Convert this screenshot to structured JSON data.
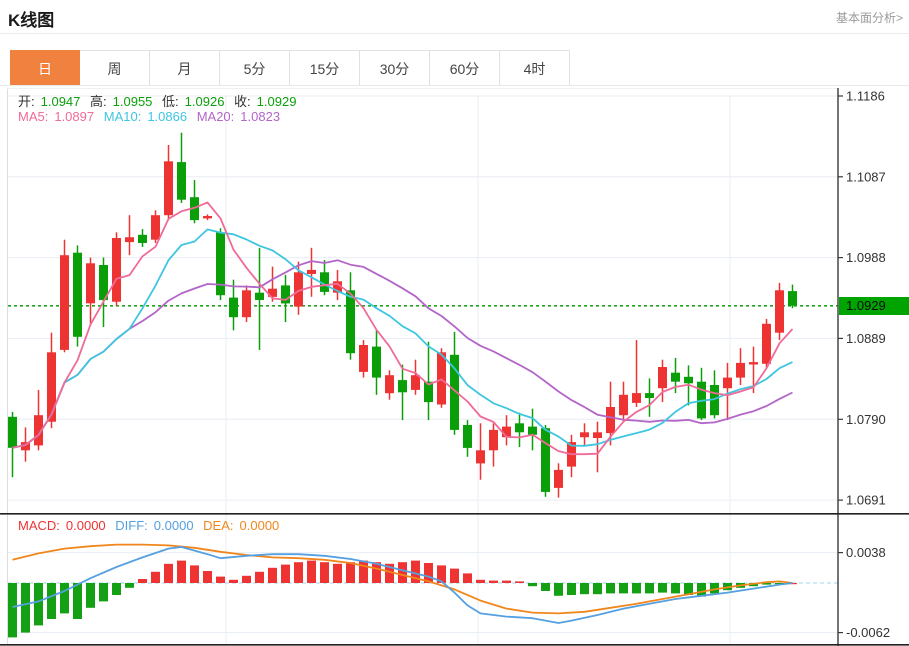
{
  "header": {
    "title": "K线图",
    "link": "基本面分析>"
  },
  "tabs": {
    "items": [
      "日",
      "周",
      "月",
      "5分",
      "15分",
      "30分",
      "60分",
      "4时"
    ],
    "active_index": 0
  },
  "ohlc": {
    "open_label": "开:",
    "open": "1.0947",
    "high_label": "高:",
    "high": "1.0955",
    "low_label": "低:",
    "low": "1.0926",
    "close_label": "收:",
    "close": "1.0929"
  },
  "ma": {
    "ma5_label": "MA5:",
    "ma5": "1.0897",
    "ma10_label": "MA10:",
    "ma10": "1.0866",
    "ma20_label": "MA20:",
    "ma20": "1.0823"
  },
  "macd_info": {
    "macd_label": "MACD:",
    "macd": "0.0000",
    "diff_label": "DIFF:",
    "diff": "0.0000",
    "dea_label": "DEA:",
    "dea": "0.0000"
  },
  "price_tag": {
    "value": "1.0929"
  },
  "colors": {
    "up_red": "#ee3333",
    "down_green": "#0a9e08",
    "ma5_pink": "#f06a9a",
    "ma10_cyan": "#3ec6e0",
    "ma20_purple": "#b365c8",
    "diff_blue": "#55a0e0",
    "dea_orange": "#f0861c",
    "hist_red": "#ee3333",
    "hist_green": "#14a014",
    "tag_green": "#00a400",
    "dotted_line_green": "#1fa81f",
    "tab_active_orange": "#f0813f",
    "grid": "#e9eef4",
    "axis_dark": "#3a3a3a",
    "zero_dash_blue": "#9ed4e8"
  },
  "chart_data": {
    "type": "candlestick+macd",
    "title": "K线图 (日)",
    "price_axis_ticks": [
      1.1186,
      1.1087,
      1.0988,
      1.0889,
      1.079,
      1.0691
    ],
    "current_price": 1.0929,
    "ma_periods": [
      5,
      10,
      20
    ],
    "macd_axis_ticks": [
      0.0038,
      -0.0062
    ],
    "candles": [
      [
        1.0793,
        1.0799,
        1.0719,
        1.0755
      ],
      [
        1.0752,
        1.078,
        1.0738,
        1.0762
      ],
      [
        1.0758,
        1.0826,
        1.0752,
        1.0795
      ],
      [
        1.0787,
        1.0896,
        1.0779,
        1.0872
      ],
      [
        1.0875,
        1.101,
        1.0872,
        1.0991
      ],
      [
        1.0994,
        1.1003,
        1.0879,
        1.0891
      ],
      [
        1.0932,
        1.0988,
        1.0906,
        1.0981
      ],
      [
        1.0979,
        1.0988,
        1.0903,
        1.0936
      ],
      [
        1.0934,
        1.1019,
        1.0929,
        1.1012
      ],
      [
        1.1007,
        1.104,
        1.0991,
        1.1013
      ],
      [
        1.1016,
        1.1023,
        1.1001,
        1.1006
      ],
      [
        1.101,
        1.1046,
        1.1006,
        1.104
      ],
      [
        1.104,
        1.1126,
        1.1034,
        1.1106
      ],
      [
        1.1105,
        1.1141,
        1.1055,
        1.1059
      ],
      [
        1.1062,
        1.1083,
        1.103,
        1.1034
      ],
      [
        1.1036,
        1.1041,
        1.1034,
        1.1039
      ],
      [
        1.1019,
        1.1024,
        1.0936,
        1.0942
      ],
      [
        1.0939,
        1.0961,
        1.0899,
        1.0915
      ],
      [
        1.0915,
        1.0954,
        1.0909,
        1.0948
      ],
      [
        1.0945,
        1.1,
        1.0875,
        1.0936
      ],
      [
        1.094,
        1.0977,
        1.0934,
        1.095
      ],
      [
        1.0954,
        1.0967,
        1.0909,
        1.0932
      ],
      [
        1.0928,
        1.0983,
        1.0918,
        1.097
      ],
      [
        1.0968,
        1.1,
        1.094,
        1.0973
      ],
      [
        1.097,
        1.0985,
        1.0942,
        1.0946
      ],
      [
        1.0945,
        1.0973,
        1.0936,
        1.0959
      ],
      [
        1.0948,
        1.097,
        1.0863,
        1.0871
      ],
      [
        1.0848,
        1.0887,
        1.0841,
        1.0881
      ],
      [
        1.0879,
        1.0899,
        1.082,
        1.0841
      ],
      [
        1.0822,
        1.085,
        1.0814,
        1.0844
      ],
      [
        1.0838,
        1.0857,
        1.0789,
        1.0823
      ],
      [
        1.0826,
        1.0863,
        1.082,
        1.0844
      ],
      [
        1.0836,
        1.0885,
        1.0789,
        1.0811
      ],
      [
        1.0808,
        1.0877,
        1.0804,
        1.0872
      ],
      [
        1.0869,
        1.0897,
        1.0771,
        1.0777
      ],
      [
        1.0783,
        1.0789,
        1.0744,
        1.0755
      ],
      [
        1.0736,
        1.0785,
        1.0716,
        1.0752
      ],
      [
        1.0752,
        1.0785,
        1.0732,
        1.0777
      ],
      [
        1.0768,
        1.0795,
        1.0758,
        1.0781
      ],
      [
        1.0785,
        1.0798,
        1.0756,
        1.0774
      ],
      [
        1.0781,
        1.0803,
        1.0752,
        1.0771
      ],
      [
        1.0779,
        1.0783,
        1.0695,
        1.0701
      ],
      [
        1.0706,
        1.0736,
        1.0694,
        1.0728
      ],
      [
        1.0732,
        1.0771,
        1.0719,
        1.0762
      ],
      [
        1.0768,
        1.0785,
        1.0758,
        1.0774
      ],
      [
        1.0767,
        1.0787,
        1.0725,
        1.0774
      ],
      [
        1.0773,
        1.0836,
        1.0758,
        1.0805
      ],
      [
        1.0795,
        1.0836,
        1.0787,
        1.082
      ],
      [
        1.081,
        1.0887,
        1.0805,
        1.0822
      ],
      [
        1.0822,
        1.084,
        1.0793,
        1.0816
      ],
      [
        1.0828,
        1.0863,
        1.0811,
        1.0854
      ],
      [
        1.0847,
        1.0865,
        1.0822,
        1.0836
      ],
      [
        1.0842,
        1.0856,
        1.0807,
        1.0834
      ],
      [
        1.0836,
        1.0853,
        1.0789,
        1.0791
      ],
      [
        1.0832,
        1.085,
        1.0791,
        1.0795
      ],
      [
        1.0828,
        1.0859,
        1.0789,
        1.0841
      ],
      [
        1.0841,
        1.0877,
        1.0832,
        1.0859
      ],
      [
        1.0857,
        1.0879,
        1.0822,
        1.086
      ],
      [
        1.0858,
        1.0913,
        1.0852,
        1.0907
      ],
      [
        1.0896,
        1.0957,
        1.0887,
        1.0948
      ],
      [
        1.0947,
        1.0955,
        1.0926,
        1.0929
      ]
    ],
    "macd_hist": [
      -0.0068,
      -0.0062,
      -0.0053,
      -0.0045,
      -0.0038,
      -0.0045,
      -0.0031,
      -0.0023,
      -0.0015,
      -0.0006,
      0.0005,
      0.0014,
      0.0024,
      0.0028,
      0.0022,
      0.0015,
      0.0008,
      0.0004,
      0.0009,
      0.0014,
      0.0019,
      0.0023,
      0.0026,
      0.0028,
      0.0026,
      0.0024,
      0.0026,
      0.0028,
      0.0026,
      0.0024,
      0.0026,
      0.0028,
      0.0025,
      0.0022,
      0.0018,
      0.0012,
      0.0004,
      0.0003,
      0.0003,
      0.0002,
      -0.0004,
      -0.001,
      -0.0016,
      -0.0015,
      -0.0014,
      -0.0014,
      -0.0013,
      -0.0013,
      -0.0013,
      -0.0013,
      -0.0012,
      -0.0013,
      -0.0015,
      -0.0017,
      -0.0013,
      -0.0009,
      -0.0006,
      -0.0004,
      -0.0002,
      -0.0001,
      0.0
    ],
    "diff_points": [
      [
        0,
        -0.003
      ],
      [
        2,
        -0.0023
      ],
      [
        4,
        -0.001
      ],
      [
        6,
        0.0006
      ],
      [
        8,
        0.002
      ],
      [
        10,
        0.0032
      ],
      [
        12,
        0.0043
      ],
      [
        13,
        0.0045
      ],
      [
        15,
        0.0036
      ],
      [
        16,
        0.0031
      ],
      [
        18,
        0.0034
      ],
      [
        20,
        0.0036
      ],
      [
        22,
        0.0036
      ],
      [
        24,
        0.0034
      ],
      [
        26,
        0.003
      ],
      [
        28,
        0.0024
      ],
      [
        30,
        0.0016
      ],
      [
        32,
        0.0008
      ],
      [
        33,
        0.0002
      ],
      [
        34,
        -0.0012
      ],
      [
        35,
        -0.0028
      ],
      [
        36,
        -0.0038
      ],
      [
        38,
        -0.0042
      ],
      [
        40,
        -0.0044
      ],
      [
        42,
        -0.005
      ],
      [
        43,
        -0.0047
      ],
      [
        45,
        -0.004
      ],
      [
        47,
        -0.0032
      ],
      [
        49,
        -0.0026
      ],
      [
        51,
        -0.002
      ],
      [
        53,
        -0.0016
      ],
      [
        55,
        -0.0012
      ],
      [
        57,
        -0.0007
      ],
      [
        59,
        -0.0002
      ],
      [
        60,
        0.0
      ]
    ],
    "dea_points": [
      [
        0,
        0.0029
      ],
      [
        2,
        0.0037
      ],
      [
        4,
        0.0043
      ],
      [
        6,
        0.0046
      ],
      [
        8,
        0.0048
      ],
      [
        10,
        0.0048
      ],
      [
        12,
        0.0047
      ],
      [
        14,
        0.0044
      ],
      [
        16,
        0.0039
      ],
      [
        18,
        0.0035
      ],
      [
        20,
        0.0032
      ],
      [
        22,
        0.0031
      ],
      [
        24,
        0.0029
      ],
      [
        26,
        0.0025
      ],
      [
        28,
        0.0018
      ],
      [
        30,
        0.001
      ],
      [
        32,
        0.0002
      ],
      [
        34,
        -0.0008
      ],
      [
        36,
        -0.0022
      ],
      [
        38,
        -0.0032
      ],
      [
        40,
        -0.0037
      ],
      [
        42,
        -0.0038
      ],
      [
        44,
        -0.0036
      ],
      [
        46,
        -0.0031
      ],
      [
        48,
        -0.0026
      ],
      [
        50,
        -0.002
      ],
      [
        52,
        -0.0014
      ],
      [
        54,
        -0.0008
      ],
      [
        56,
        -0.0003
      ],
      [
        58,
        0.0001
      ],
      [
        59,
        0.0002
      ],
      [
        60,
        0.0
      ]
    ]
  }
}
